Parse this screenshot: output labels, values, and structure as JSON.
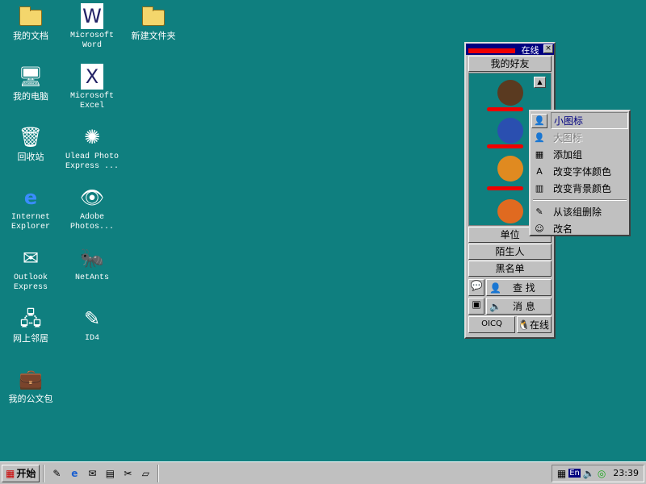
{
  "desktop": [
    {
      "label": "我的文档",
      "col": 0,
      "row": 0,
      "icon": "my-documents-icon"
    },
    {
      "label": "我的电脑",
      "col": 0,
      "row": 1,
      "icon": "my-computer-icon"
    },
    {
      "label": "回收站",
      "col": 0,
      "row": 2,
      "icon": "recycle-bin-icon"
    },
    {
      "label": "Internet Explorer",
      "col": 0,
      "row": 3,
      "icon": "ie-icon"
    },
    {
      "label": "Outlook Express",
      "col": 0,
      "row": 4,
      "icon": "outlook-icon"
    },
    {
      "label": "网上邻居",
      "col": 0,
      "row": 5,
      "icon": "network-icon"
    },
    {
      "label": "我的公文包",
      "col": 0,
      "row": 6,
      "icon": "briefcase-icon"
    },
    {
      "label": "Microsoft Word",
      "col": 1,
      "row": 0,
      "icon": "word-icon"
    },
    {
      "label": "Microsoft Excel",
      "col": 1,
      "row": 1,
      "icon": "excel-icon"
    },
    {
      "label": "Ulead Photo Express ...",
      "col": 1,
      "row": 2,
      "icon": "ulead-icon"
    },
    {
      "label": "Adobe Photos...",
      "col": 1,
      "row": 3,
      "icon": "photoshop-icon"
    },
    {
      "label": "NetAnts",
      "col": 1,
      "row": 4,
      "icon": "netants-icon"
    },
    {
      "label": "ID4",
      "col": 1,
      "row": 5,
      "icon": "id4-icon"
    },
    {
      "label": "新建文件夹",
      "col": 2,
      "row": 0,
      "icon": "folder-icon"
    }
  ],
  "qq": {
    "title": "在线",
    "group_friends": "我的好友",
    "group_unit": "单位",
    "group_strangers": "陌生人",
    "group_blacklist": "黑名单",
    "find": "查 找",
    "messages": "消 息",
    "logo": "OICQ",
    "status": "在线"
  },
  "menu": [
    {
      "label": "小图标",
      "icon": "small-icon-icon",
      "state": "selected"
    },
    {
      "label": "大图标",
      "icon": "large-icon-icon",
      "state": "disabled"
    },
    {
      "label": "添加组",
      "icon": "add-group-icon",
      "state": "normal"
    },
    {
      "label": "改变字体颜色",
      "icon": "font-color-icon",
      "state": "normal"
    },
    {
      "label": "改变背景颜色",
      "icon": "background-color-icon",
      "state": "normal"
    },
    {
      "label": "从该组删除",
      "icon": "delete-icon",
      "state": "normal",
      "sep_before": true
    },
    {
      "label": "改名",
      "icon": "rename-icon",
      "state": "normal"
    }
  ],
  "taskbar": {
    "start": "开始",
    "ime": "En",
    "clock": "23:39"
  }
}
